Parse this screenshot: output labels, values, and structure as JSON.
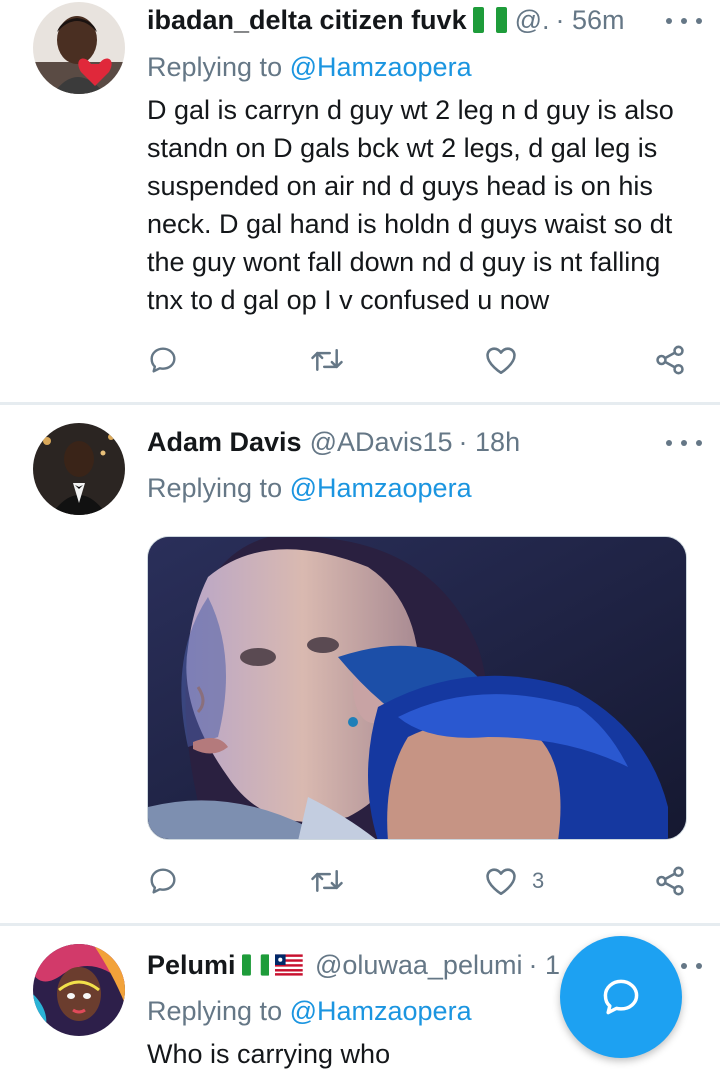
{
  "tweets": [
    {
      "name": "ibadan_delta citizen fuvk",
      "handle": "@.",
      "time": "· 56m",
      "replying_label": "Replying to ",
      "mention": "@Hamzaopera",
      "text_lines": [
        "D gal is carryn d guy wt 2 leg n d guy is also",
        "standn on D gals bck wt 2 legs, d gal leg is",
        "suspended on air nd d guys head is on his",
        "neck. D gal hand is holdn d guys waist so dt",
        "the guy wont fall down nd d guy is nt falling",
        "tnx to d gal op I v confused u now"
      ],
      "like_count": ""
    },
    {
      "name": "Adam Davis",
      "handle": "@ADavis15",
      "time": "· 18h",
      "replying_label": "Replying to ",
      "mention": "@Hamzaopera",
      "like_count": "3"
    },
    {
      "name": "Pelumi",
      "handle": "@oluwaa_pelumi",
      "time": "· 1",
      "replying_label": "Replying to ",
      "mention": "@Hamzaopera",
      "text": "Who is carrying who"
    }
  ],
  "colors": {
    "accent": "#1da1f2",
    "mention": "#1b95e0",
    "secondary_text": "#657786",
    "divider": "#e6ecf0"
  },
  "icons": [
    "reply-icon",
    "retweet-icon",
    "like-icon",
    "share-icon",
    "more-icon",
    "compose-icon",
    "nigeria-flag-icon",
    "liberia-flag-icon"
  ]
}
